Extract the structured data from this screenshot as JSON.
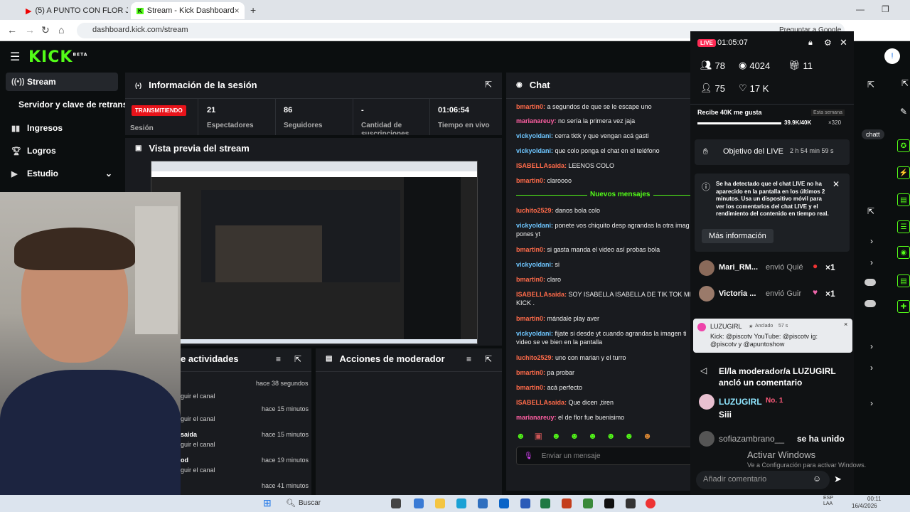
{
  "browser": {
    "tabs": [
      {
        "label": "(5) A PUNTO CON FLOR JA..."
      },
      {
        "label": "Stream - Kick Dashboard"
      }
    ],
    "url": "dashboard.kick.com/stream",
    "google_btn": "Preguntar a Google"
  },
  "sidebar": {
    "items": [
      {
        "label": "Stream",
        "icon": "broadcast-icon"
      },
      {
        "label": "Servidor y clave de retransn",
        "icon": "none"
      },
      {
        "label": "Ingresos",
        "icon": "bars-icon"
      },
      {
        "label": "Logros",
        "icon": "trophy-icon"
      },
      {
        "label": "Estudio",
        "icon": "video-icon"
      }
    ]
  },
  "session": {
    "title": "Información de la sesión",
    "status_badge": "TRANSMITIENDO",
    "session_label": "Sesión",
    "stats": [
      {
        "value": "21",
        "label": "Espectadores"
      },
      {
        "value": "86",
        "label": "Seguidores"
      },
      {
        "value": "-",
        "label": "Cantidad de suscripciones"
      },
      {
        "value": "01:06:54",
        "label": "Tiempo en vivo"
      }
    ]
  },
  "preview": {
    "title": "Vista previa del stream"
  },
  "activity": {
    "title": "e actividades",
    "rows": [
      {
        "name": "",
        "sub": "guir el canal",
        "time": "hace 38 segundos"
      },
      {
        "name": "",
        "sub": "guir el canal",
        "time": "hace 15 minutos"
      },
      {
        "name": "saida",
        "sub": "guir el canal",
        "time": "hace 15 minutos"
      },
      {
        "name": "od",
        "sub": "guir el canal",
        "time": "hace 19 minutos"
      },
      {
        "name": "",
        "sub": "",
        "time": "hace 41 minutos"
      }
    ]
  },
  "moderator": {
    "title": "Acciones de moderador"
  },
  "chat": {
    "title": "Chat",
    "new_messages": "Nuevos mensajes",
    "input_placeholder": "Enviar un mensaje",
    "messages": [
      {
        "user": "bmartin0",
        "color": "#ff6b4a",
        "text": "a segundos de que se le escape uno"
      },
      {
        "user": "marianareuy",
        "color": "#ff5fa2",
        "text": "no sería la primera vez jaja"
      },
      {
        "user": "vickyoldani",
        "color": "#6ec6ff",
        "text": "cerra tktk y que vengan acá gasti"
      },
      {
        "user": "vickyoldani",
        "color": "#6ec6ff",
        "text": "que colo ponga el chat en el teléfono"
      },
      {
        "user": "ISABELLAsaida",
        "color": "#ff6b4a",
        "text": "LEENOS COLO"
      },
      {
        "user": "bmartin0",
        "color": "#ff6b4a",
        "text": "claroooo"
      },
      {
        "user": "luchito2529",
        "color": "#ff6b4a",
        "text": "danos bola colo"
      },
      {
        "user": "vickyoldani",
        "color": "#6ec6ff",
        "text": "ponete vos chiquito desp agrandas la otra imag"
      },
      {
        "user": "",
        "color": "#eee",
        "text": "pones yt"
      },
      {
        "user": "bmartin0",
        "color": "#ff6b4a",
        "text": "si gasta manda el video así probas bola"
      },
      {
        "user": "vickyoldani",
        "color": "#6ec6ff",
        "text": "si"
      },
      {
        "user": "bmartin0",
        "color": "#ff6b4a",
        "text": "claro"
      },
      {
        "user": "ISABELLAsaida",
        "color": "#ff6b4a",
        "text": "SOY ISABELLA ISABELLA DE TIK TOK ME V"
      },
      {
        "user": "",
        "color": "#eee",
        "text": "KICK ."
      },
      {
        "user": "bmartin0",
        "color": "#ff6b4a",
        "text": "mándale play aver"
      },
      {
        "user": "vickyoldani",
        "color": "#6ec6ff",
        "text": "fijate si desde yt cuando agrandas la imagen ti"
      },
      {
        "user": "",
        "color": "#eee",
        "text": "video se ve bien en la pantalla"
      },
      {
        "user": "luchito2529",
        "color": "#ff6b4a",
        "text": "uno con marian y el turro"
      },
      {
        "user": "bmartin0",
        "color": "#ff6b4a",
        "text": "pa probar"
      },
      {
        "user": "bmartin0",
        "color": "#ff6b4a",
        "text": "acá perfecto"
      },
      {
        "user": "ISABELLAsaida",
        "color": "#ff6b4a",
        "text": "Que dicen ,tiren"
      },
      {
        "user": "marianareuy",
        "color": "#ff5fa2",
        "text": "el de flor fue buenisimo"
      }
    ]
  },
  "overlay": {
    "live_badge": "LIVE",
    "time": "01:05:07",
    "stats": [
      {
        "value": "78",
        "icon": "users-icon"
      },
      {
        "value": "4024",
        "icon": "eye-icon"
      },
      {
        "value": "11",
        "icon": "gift-icon"
      },
      {
        "value": "75",
        "icon": "user-plus-icon"
      },
      {
        "value": "17 K",
        "icon": "heart-icon"
      }
    ],
    "goal_label": "Recibe 40K me gusta",
    "goal_period": "Esta semana",
    "goal_progress": "39.9K/40K",
    "goal_fraction": 0.9975,
    "goal_reward": "×320",
    "live_goal_label": "Objetivo del LIVE",
    "live_goal_time": "2 h 54 min 59 s",
    "notice": "Se ha detectado que el chat LIVE no ha aparecido en la pantalla en los últimos 2 minutos. Usa un dispositivo móvil para ver los comentarios del chat LIVE y el rendimiento del contenido en tiempo real.",
    "more_info": "Más información",
    "gifts": [
      {
        "name": "Mari_RM...",
        "action": "envió Quié",
        "count": "×1"
      },
      {
        "name": "Victoria ...",
        "action": "envió Guir",
        "count": "×1"
      }
    ],
    "popup": {
      "user": "LUZUGIRL",
      "tag": "Anclado",
      "age": "57 s",
      "text": "Kick: @piscotv YouTube: @piscotv ig: @piscotv y @apuntoshow"
    },
    "pin_notice": "El/la moderador/a LUZUGIRL ancló un comentario",
    "luz_name": "LUZUGIRL",
    "luz_rank": "No. 1",
    "luz_msg": "Siii",
    "join_user": "sofiazambrano__",
    "join_text": "se ha unido",
    "comment_placeholder": "Añadir comentario",
    "watermark": "Activar Windows",
    "watermark_sub": "Ve a Configuración para activar Windows."
  },
  "taskbar": {
    "search": "Buscar",
    "time": "00:11",
    "date": "16/4/2026",
    "lang": "ESP LAA"
  }
}
